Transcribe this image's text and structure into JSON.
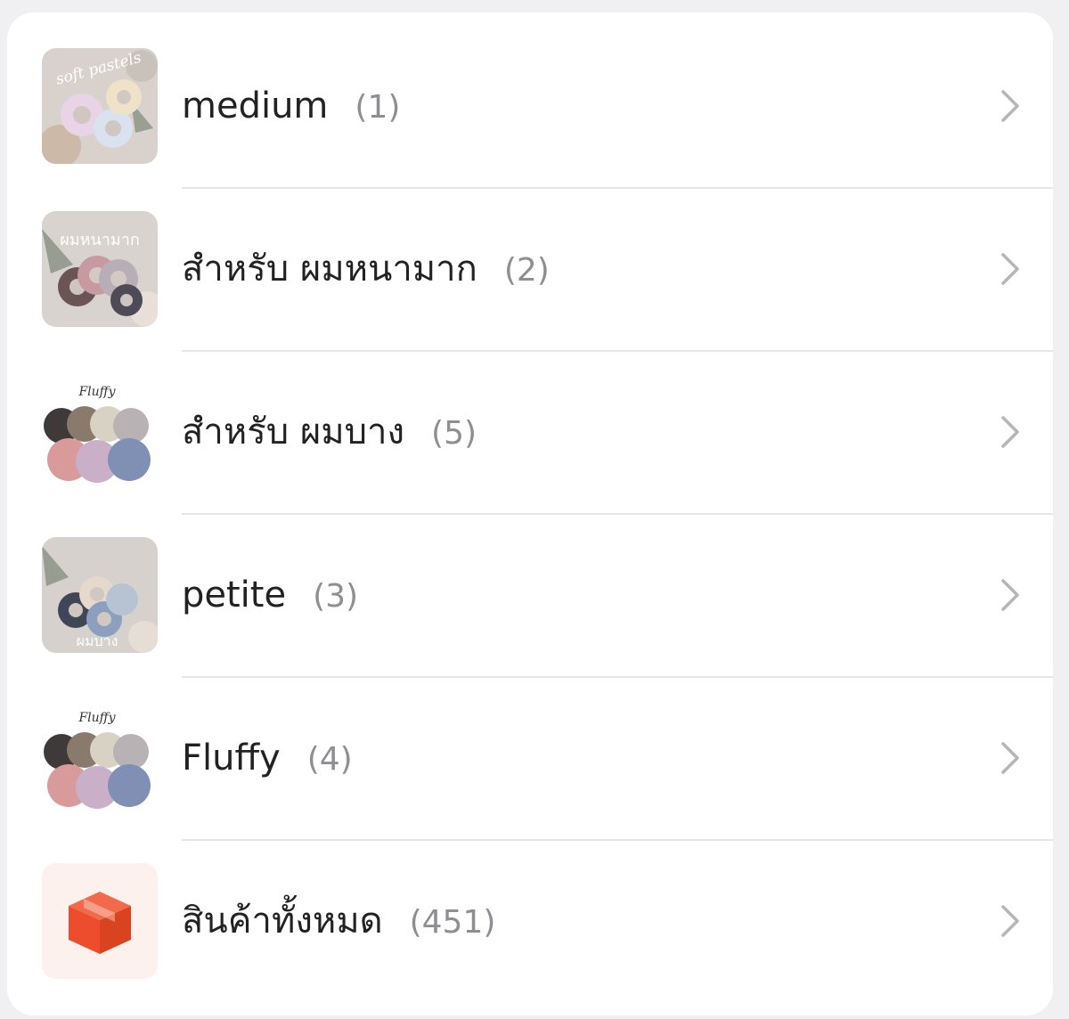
{
  "categories": [
    {
      "name": "medium",
      "count": "(1)",
      "thumb_icon": "scrunchie-photo-soft-pastels",
      "thumb_caption": "soft pastels"
    },
    {
      "name": "สำหรับ ผมหนามาก",
      "count": "(2)",
      "thumb_icon": "scrunchie-photo-thick-hair",
      "thumb_caption": "ผมหนามาก"
    },
    {
      "name": "สำหรับ ผมบาง",
      "count": "(5)",
      "thumb_icon": "scrunchie-photo-fluffy",
      "thumb_caption": "Fluffy"
    },
    {
      "name": "petite",
      "count": "(3)",
      "thumb_icon": "scrunchie-photo-thin-hair",
      "thumb_caption": "ผมบาง"
    },
    {
      "name": "Fluffy",
      "count": "(4)",
      "thumb_icon": "scrunchie-photo-fluffy",
      "thumb_caption": "Fluffy"
    },
    {
      "name": "สินค้าทั้งหมด",
      "count": "(451)",
      "thumb_icon": "box-icon"
    }
  ],
  "colors": {
    "box_orange": "#ee4d2d",
    "box_bg": "#fdf1ee",
    "chevron": "#b5b5ba",
    "divider": "#e6e6e8"
  }
}
